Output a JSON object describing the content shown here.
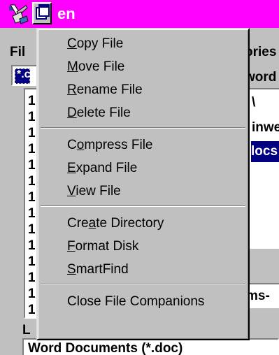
{
  "titlebar": {
    "title_fragment": "en"
  },
  "background": {
    "label_file_fragment": "Fil",
    "label_directories_fragment": "ories",
    "filter_fragment": "*.c",
    "word_fragment": "word",
    "list_marks": [
      "1",
      "1",
      "1",
      "1",
      "1",
      "1",
      "1",
      "1",
      "1",
      "1",
      "1",
      "1",
      "1",
      "1"
    ],
    "dir_lines": [
      "\\",
      "inwe",
      "locs"
    ],
    "drive_fragment": "ms-",
    "list_files_type_fragment": "L",
    "file_type_value": "Word Documents (*.doc)"
  },
  "popup_menu": {
    "groups": [
      [
        {
          "label": "Copy File",
          "mnemonic": "C"
        },
        {
          "label": "Move File",
          "mnemonic": "M"
        },
        {
          "label": "Rename File",
          "mnemonic": "R"
        },
        {
          "label": "Delete File",
          "mnemonic": "D"
        }
      ],
      [
        {
          "label": "Compress File",
          "mnemonic": "o"
        },
        {
          "label": "Expand File",
          "mnemonic": "E"
        },
        {
          "label": "View File",
          "mnemonic": "V"
        }
      ],
      [
        {
          "label": "Create Directory",
          "mnemonic": "a"
        },
        {
          "label": "Format Disk",
          "mnemonic": "F"
        },
        {
          "label": "SmartFind",
          "mnemonic": "S"
        }
      ],
      [
        {
          "label": "Close File Companions",
          "mnemonic": ""
        }
      ]
    ]
  },
  "colors": {
    "titlebar": "#ff00ff",
    "face": "#c0c0c0",
    "selection": "#000080"
  },
  "icons": {
    "app": "file-companions-app-icon",
    "control_menu": "control-menu-icon"
  }
}
